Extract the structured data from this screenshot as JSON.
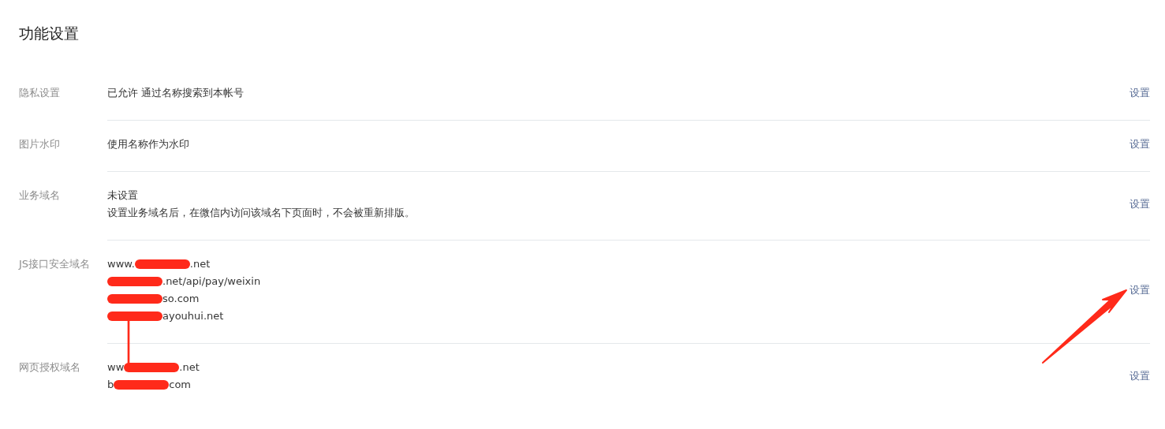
{
  "title": "功能设置",
  "rows": [
    {
      "label": "隐私设置",
      "lines": [
        {
          "text": "已允许 通过名称搜索到本帐号"
        }
      ],
      "action": "设置"
    },
    {
      "label": "图片水印",
      "lines": [
        {
          "text": "使用名称作为水印"
        }
      ],
      "action": "设置"
    },
    {
      "label": "业务域名",
      "lines": [
        {
          "text": "未设置"
        },
        {
          "text": "设置业务域名后，在微信内访问该域名下页面时，不会被重新排版。"
        }
      ],
      "action": "设置"
    },
    {
      "label": "JS接口安全域名",
      "lines": [
        {
          "redacted": true,
          "before": "www.",
          "after": ".net"
        },
        {
          "redacted": true,
          "after": ".net/api/pay/weixin"
        },
        {
          "redacted": true,
          "after": "so.com"
        },
        {
          "redacted": true,
          "after": "ayouhui.net"
        }
      ],
      "action": "设置"
    },
    {
      "label": "网页授权域名",
      "lines": [
        {
          "redacted": true,
          "before": "ww",
          "after": ".net"
        },
        {
          "redacted": true,
          "before": "b",
          "after": "com"
        }
      ],
      "action": "设置"
    }
  ]
}
